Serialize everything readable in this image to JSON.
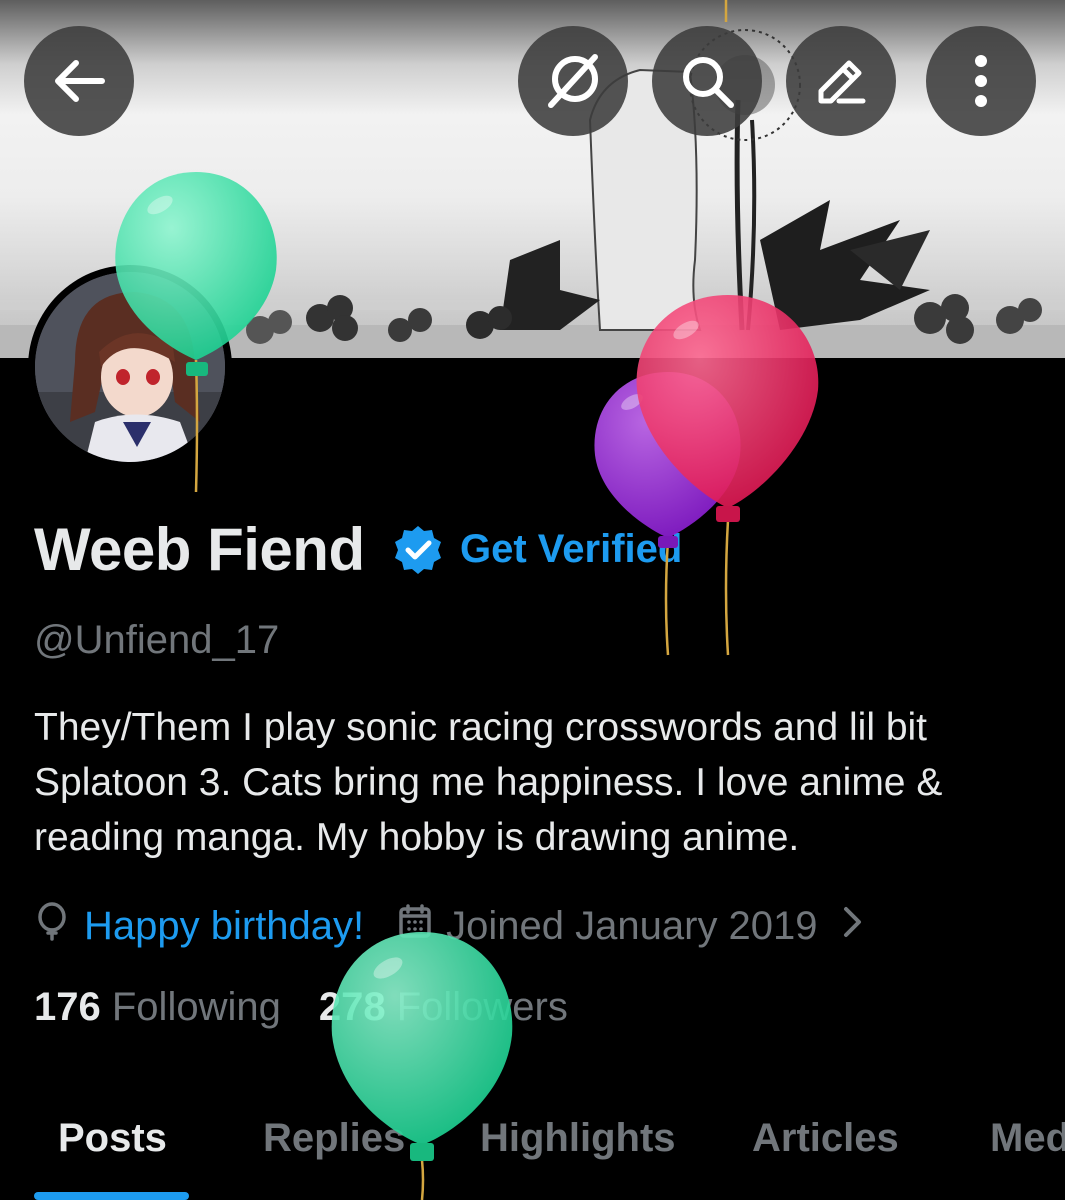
{
  "header": {
    "back_icon": "arrow-left-icon",
    "actions": [
      {
        "name": "grok-icon"
      },
      {
        "name": "search-icon"
      },
      {
        "name": "edit-icon"
      },
      {
        "name": "more-vertical-icon"
      }
    ]
  },
  "profile": {
    "display_name": "Weeb Fiend",
    "get_verified": "Get Verified",
    "handle": "@Unfiend_17",
    "bio": "They/Them  I play sonic racing crosswords and lil bit Splatoon 3. Cats bring me happiness. I love anime & reading manga. My hobby is drawing anime.",
    "birthday_text": "Happy birthday!",
    "joined_text": "Joined January 2019",
    "following_count": "176",
    "following_label": "Following",
    "followers_count": "278",
    "followers_label": "Followers"
  },
  "tabs": [
    {
      "label": "Posts",
      "active": true
    },
    {
      "label": "Replies"
    },
    {
      "label": "Highlights"
    },
    {
      "label": "Articles"
    },
    {
      "label": "Media"
    }
  ],
  "colors": {
    "accent": "#1d9bf0",
    "background": "#000000",
    "text_primary": "#e7e9ea",
    "text_secondary": "#71767b"
  }
}
